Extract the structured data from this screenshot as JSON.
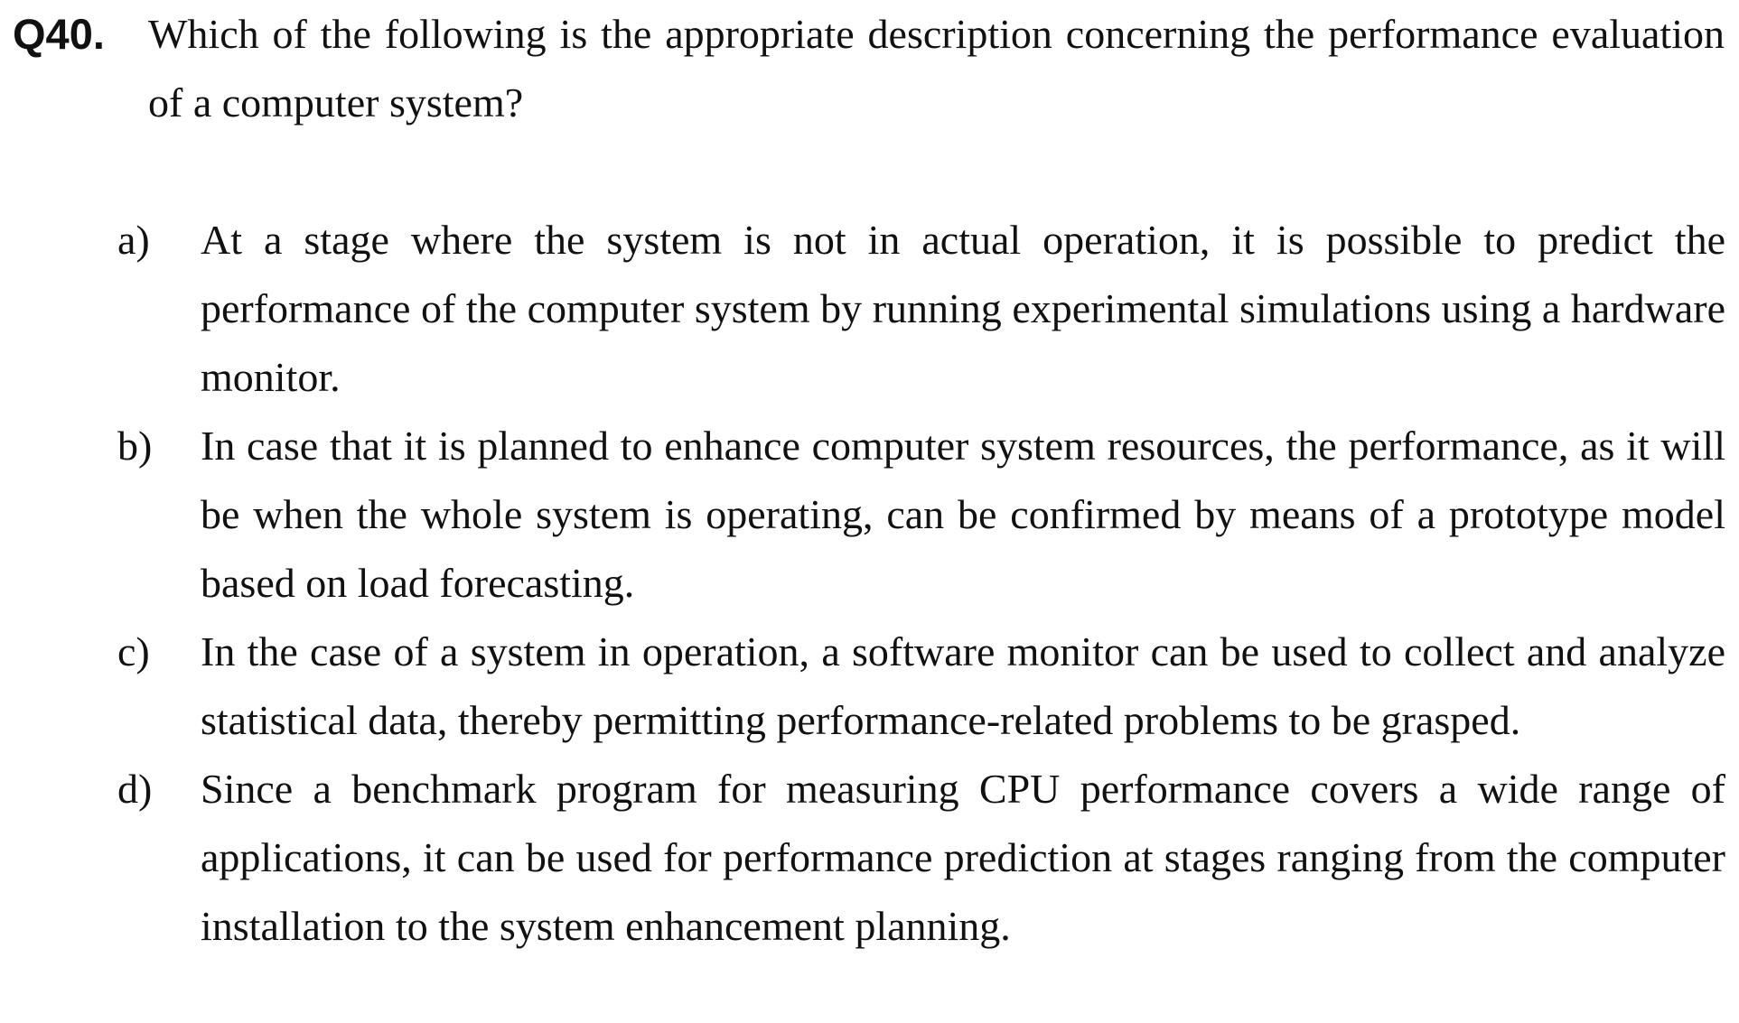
{
  "question": {
    "number": "Q40.",
    "text": "Which of the following is the appropriate description concerning the performance evaluation of a computer system?"
  },
  "options": [
    {
      "letter": "a)",
      "text": "At a stage where the system is not in actual operation, it is possible to predict the performance of the computer system by running experimental simulations using a hardware monitor."
    },
    {
      "letter": "b)",
      "text": "In case that it is planned to enhance computer system resources, the performance, as it will be when the whole system is operating, can be confirmed by means of a prototype model based on load forecasting."
    },
    {
      "letter": "c)",
      "text": "In the case of a system in operation, a software monitor can be used to collect and analyze statistical data, thereby permitting performance-related problems to be grasped."
    },
    {
      "letter": "d)",
      "text": "Since a benchmark program for measuring CPU performance covers a wide range of applications, it can be used for performance prediction at stages ranging from the computer installation to the system enhancement planning."
    }
  ]
}
